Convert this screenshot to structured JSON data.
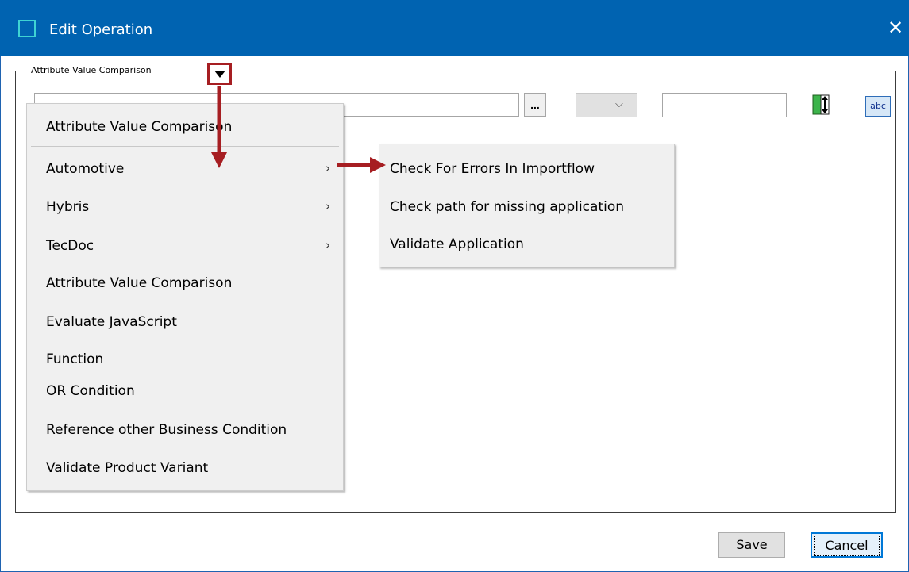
{
  "window": {
    "title": "Edit Operation",
    "close_glyph": "✕",
    "accent_color": "#0063b1"
  },
  "group": {
    "legend": "Attribute Value Comparison"
  },
  "fields": {
    "ellipsis_label": "...",
    "combo_chevron": "⌵",
    "abc_label": "abc"
  },
  "menu": {
    "header_item": "Attribute Value Comparison",
    "items": [
      {
        "label": "Automotive",
        "submenu": true
      },
      {
        "label": "Hybris",
        "submenu": true
      },
      {
        "label": "TecDoc",
        "submenu": true
      },
      {
        "label": "Attribute Value Comparison",
        "submenu": false
      },
      {
        "label": "Evaluate JavaScript",
        "submenu": false
      },
      {
        "label": "Function",
        "submenu": false
      },
      {
        "label": "OR Condition",
        "submenu": false
      },
      {
        "label": "Reference other Business Condition",
        "submenu": false
      },
      {
        "label": "Validate Product Variant",
        "submenu": false
      }
    ],
    "submenu_glyph": "›"
  },
  "submenu": {
    "items": [
      {
        "label": "Check For Errors In Importflow"
      },
      {
        "label": "Check path for missing application"
      },
      {
        "label": "Validate Application"
      }
    ]
  },
  "annotation": {
    "arrow_color": "#a61e22"
  },
  "footer": {
    "save_label": "Save",
    "cancel_label": "Cancel"
  }
}
